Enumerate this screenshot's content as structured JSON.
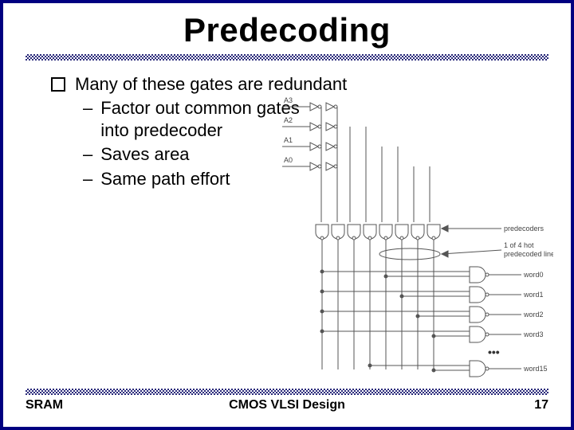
{
  "title": "Predecoding",
  "bullet": "Many of these gates are redundant",
  "subitems": [
    "Factor out common gates into predecoder",
    "Saves area",
    "Same path effort"
  ],
  "diagram_labels": {
    "a3": "A3",
    "a2": "A2",
    "a1": "A1",
    "a0": "A0",
    "predecoders": "predecoders",
    "hot1": "1 of 4 hot",
    "hot2": "predecoded lines",
    "word0": "word0",
    "word1": "word1",
    "word2": "word2",
    "word3": "word3",
    "word15": "word15",
    "dots": "•••"
  },
  "footer": {
    "left": "SRAM",
    "center": "CMOS VLSI Design",
    "right": "17"
  }
}
